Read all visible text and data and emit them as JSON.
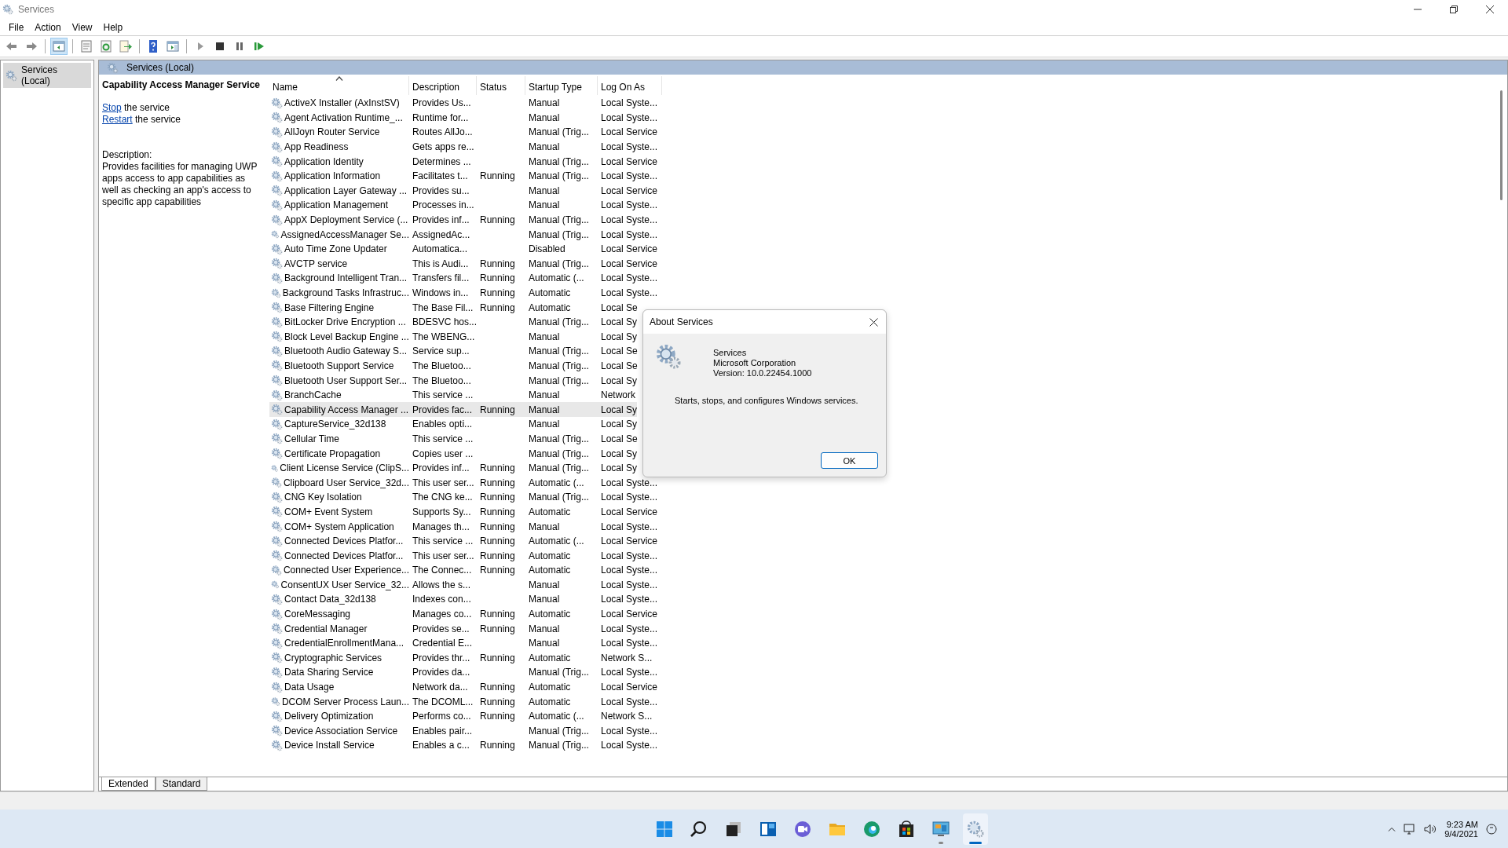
{
  "window": {
    "title": "Services"
  },
  "menu": [
    "File",
    "Action",
    "View",
    "Help"
  ],
  "toolbar": [
    {
      "kind": "back",
      "pressed": false
    },
    {
      "kind": "forward",
      "pressed": false
    },
    {
      "kind": "sep"
    },
    {
      "kind": "tree",
      "pressed": true
    },
    {
      "kind": "sep"
    },
    {
      "kind": "properties",
      "pressed": false
    },
    {
      "kind": "refresh",
      "pressed": false
    },
    {
      "kind": "export",
      "pressed": false
    },
    {
      "kind": "sep"
    },
    {
      "kind": "help",
      "pressed": false
    },
    {
      "kind": "actionpane",
      "pressed": false
    },
    {
      "kind": "sep"
    },
    {
      "kind": "start",
      "pressed": false
    },
    {
      "kind": "stop",
      "pressed": false
    },
    {
      "kind": "pause",
      "pressed": false
    },
    {
      "kind": "resume",
      "pressed": false
    }
  ],
  "tree": {
    "items": [
      {
        "label": "Services (Local)",
        "selected": true
      }
    ]
  },
  "pane_header": "Services (Local)",
  "details": {
    "title": "Capability Access Manager Service",
    "actions": [
      {
        "link": "Stop",
        "text": "the service"
      },
      {
        "link": "Restart",
        "text": "the service"
      }
    ],
    "description_label": "Description:",
    "description": "Provides facilities for managing UWP apps access to app capabilities as well as checking an app's access to specific app capabilities"
  },
  "table": {
    "columns": [
      {
        "label": "Name",
        "sorted": true
      },
      {
        "label": "Description",
        "sorted": false
      },
      {
        "label": "Status",
        "sorted": false
      },
      {
        "label": "Startup Type",
        "sorted": false
      },
      {
        "label": "Log On As",
        "sorted": false
      }
    ],
    "rows": [
      {
        "cells": [
          "ActiveX Installer (AxInstSV)",
          "Provides Us...",
          "",
          "Manual",
          "Local Syste..."
        ],
        "selected": false
      },
      {
        "cells": [
          "Agent Activation Runtime_...",
          "Runtime for...",
          "",
          "Manual",
          "Local Syste..."
        ],
        "selected": false
      },
      {
        "cells": [
          "AllJoyn Router Service",
          "Routes AllJo...",
          "",
          "Manual (Trig...",
          "Local Service"
        ],
        "selected": false
      },
      {
        "cells": [
          "App Readiness",
          "Gets apps re...",
          "",
          "Manual",
          "Local Syste..."
        ],
        "selected": false
      },
      {
        "cells": [
          "Application Identity",
          "Determines ...",
          "",
          "Manual (Trig...",
          "Local Service"
        ],
        "selected": false
      },
      {
        "cells": [
          "Application Information",
          "Facilitates t...",
          "Running",
          "Manual (Trig...",
          "Local Syste..."
        ],
        "selected": false
      },
      {
        "cells": [
          "Application Layer Gateway ...",
          "Provides su...",
          "",
          "Manual",
          "Local Service"
        ],
        "selected": false
      },
      {
        "cells": [
          "Application Management",
          "Processes in...",
          "",
          "Manual",
          "Local Syste..."
        ],
        "selected": false
      },
      {
        "cells": [
          "AppX Deployment Service (...",
          "Provides inf...",
          "Running",
          "Manual (Trig...",
          "Local Syste..."
        ],
        "selected": false
      },
      {
        "cells": [
          "AssignedAccessManager Se...",
          "AssignedAc...",
          "",
          "Manual (Trig...",
          "Local Syste..."
        ],
        "selected": false
      },
      {
        "cells": [
          "Auto Time Zone Updater",
          "Automatica...",
          "",
          "Disabled",
          "Local Service"
        ],
        "selected": false
      },
      {
        "cells": [
          "AVCTP service",
          "This is Audi...",
          "Running",
          "Manual (Trig...",
          "Local Service"
        ],
        "selected": false
      },
      {
        "cells": [
          "Background Intelligent Tran...",
          "Transfers fil...",
          "Running",
          "Automatic (...",
          "Local Syste..."
        ],
        "selected": false
      },
      {
        "cells": [
          "Background Tasks Infrastruc...",
          "Windows in...",
          "Running",
          "Automatic",
          "Local Syste..."
        ],
        "selected": false
      },
      {
        "cells": [
          "Base Filtering Engine",
          "The Base Fil...",
          "Running",
          "Automatic",
          "Local Se"
        ],
        "selected": false
      },
      {
        "cells": [
          "BitLocker Drive Encryption ...",
          "BDESVC hos...",
          "",
          "Manual (Trig...",
          "Local Sy"
        ],
        "selected": false
      },
      {
        "cells": [
          "Block Level Backup Engine ...",
          "The WBENG...",
          "",
          "Manual",
          "Local Sy"
        ],
        "selected": false
      },
      {
        "cells": [
          "Bluetooth Audio Gateway S...",
          "Service sup...",
          "",
          "Manual (Trig...",
          "Local Se"
        ],
        "selected": false
      },
      {
        "cells": [
          "Bluetooth Support Service",
          "The Bluetoo...",
          "",
          "Manual (Trig...",
          "Local Se"
        ],
        "selected": false
      },
      {
        "cells": [
          "Bluetooth User Support Ser...",
          "The Bluetoo...",
          "",
          "Manual (Trig...",
          "Local Sy"
        ],
        "selected": false
      },
      {
        "cells": [
          "BranchCache",
          "This service ...",
          "",
          "Manual",
          "Network"
        ],
        "selected": false
      },
      {
        "cells": [
          "Capability Access Manager ...",
          "Provides fac...",
          "Running",
          "Manual",
          "Local Sy"
        ],
        "selected": true
      },
      {
        "cells": [
          "CaptureService_32d138",
          "Enables opti...",
          "",
          "Manual",
          "Local Sy"
        ],
        "selected": false
      },
      {
        "cells": [
          "Cellular Time",
          "This service ...",
          "",
          "Manual (Trig...",
          "Local Se"
        ],
        "selected": false
      },
      {
        "cells": [
          "Certificate Propagation",
          "Copies user ...",
          "",
          "Manual (Trig...",
          "Local Sy"
        ],
        "selected": false
      },
      {
        "cells": [
          "Client License Service (ClipS...",
          "Provides inf...",
          "Running",
          "Manual (Trig...",
          "Local Sy"
        ],
        "selected": false
      },
      {
        "cells": [
          "Clipboard User Service_32d...",
          "This user ser...",
          "Running",
          "Automatic (...",
          "Local Syste..."
        ],
        "selected": false
      },
      {
        "cells": [
          "CNG Key Isolation",
          "The CNG ke...",
          "Running",
          "Manual (Trig...",
          "Local Syste..."
        ],
        "selected": false
      },
      {
        "cells": [
          "COM+ Event System",
          "Supports Sy...",
          "Running",
          "Automatic",
          "Local Service"
        ],
        "selected": false
      },
      {
        "cells": [
          "COM+ System Application",
          "Manages th...",
          "Running",
          "Manual",
          "Local Syste..."
        ],
        "selected": false
      },
      {
        "cells": [
          "Connected Devices Platfor...",
          "This service ...",
          "Running",
          "Automatic (...",
          "Local Service"
        ],
        "selected": false
      },
      {
        "cells": [
          "Connected Devices Platfor...",
          "This user ser...",
          "Running",
          "Automatic",
          "Local Syste..."
        ],
        "selected": false
      },
      {
        "cells": [
          "Connected User Experience...",
          "The Connec...",
          "Running",
          "Automatic",
          "Local Syste..."
        ],
        "selected": false
      },
      {
        "cells": [
          "ConsentUX User Service_32...",
          "Allows the s...",
          "",
          "Manual",
          "Local Syste..."
        ],
        "selected": false
      },
      {
        "cells": [
          "Contact Data_32d138",
          "Indexes con...",
          "",
          "Manual",
          "Local Syste..."
        ],
        "selected": false
      },
      {
        "cells": [
          "CoreMessaging",
          "Manages co...",
          "Running",
          "Automatic",
          "Local Service"
        ],
        "selected": false
      },
      {
        "cells": [
          "Credential Manager",
          "Provides se...",
          "Running",
          "Manual",
          "Local Syste..."
        ],
        "selected": false
      },
      {
        "cells": [
          "CredentialEnrollmentMana...",
          "Credential E...",
          "",
          "Manual",
          "Local Syste..."
        ],
        "selected": false
      },
      {
        "cells": [
          "Cryptographic Services",
          "Provides thr...",
          "Running",
          "Automatic",
          "Network S..."
        ],
        "selected": false
      },
      {
        "cells": [
          "Data Sharing Service",
          "Provides da...",
          "",
          "Manual (Trig...",
          "Local Syste..."
        ],
        "selected": false
      },
      {
        "cells": [
          "Data Usage",
          "Network da...",
          "Running",
          "Automatic",
          "Local Service"
        ],
        "selected": false
      },
      {
        "cells": [
          "DCOM Server Process Laun...",
          "The DCOML...",
          "Running",
          "Automatic",
          "Local Syste..."
        ],
        "selected": false
      },
      {
        "cells": [
          "Delivery Optimization",
          "Performs co...",
          "Running",
          "Automatic (...",
          "Network S..."
        ],
        "selected": false
      },
      {
        "cells": [
          "Device Association Service",
          "Enables pair...",
          "",
          "Manual (Trig...",
          "Local Syste..."
        ],
        "selected": false
      },
      {
        "cells": [
          "Device Install Service",
          "Enables a c...",
          "Running",
          "Manual (Trig...",
          "Local Syste..."
        ],
        "selected": false
      }
    ]
  },
  "view_tabs": [
    {
      "label": "Extended",
      "selected": true
    },
    {
      "label": "Standard",
      "selected": false
    }
  ],
  "dialog": {
    "title": "About Services",
    "product": "Services",
    "company": "Microsoft Corporation",
    "version": "Version: 10.0.22454.1000",
    "description": "Starts, stops, and configures Windows services.",
    "button": "OK"
  },
  "taskbar": {
    "apps": [
      {
        "kind": "start",
        "running": false,
        "active": false
      },
      {
        "kind": "search",
        "running": false,
        "active": false
      },
      {
        "kind": "taskview",
        "running": false,
        "active": false
      },
      {
        "kind": "widgets",
        "running": false,
        "active": false
      },
      {
        "kind": "chat",
        "running": false,
        "active": false
      },
      {
        "kind": "explorer",
        "running": false,
        "active": false
      },
      {
        "kind": "edge",
        "running": false,
        "active": false
      },
      {
        "kind": "store",
        "running": false,
        "active": false
      },
      {
        "kind": "monitor",
        "running": true,
        "active": false
      },
      {
        "kind": "gears",
        "running": true,
        "active": true
      }
    ],
    "time": "9:23 AM",
    "date": "9/4/2021"
  }
}
